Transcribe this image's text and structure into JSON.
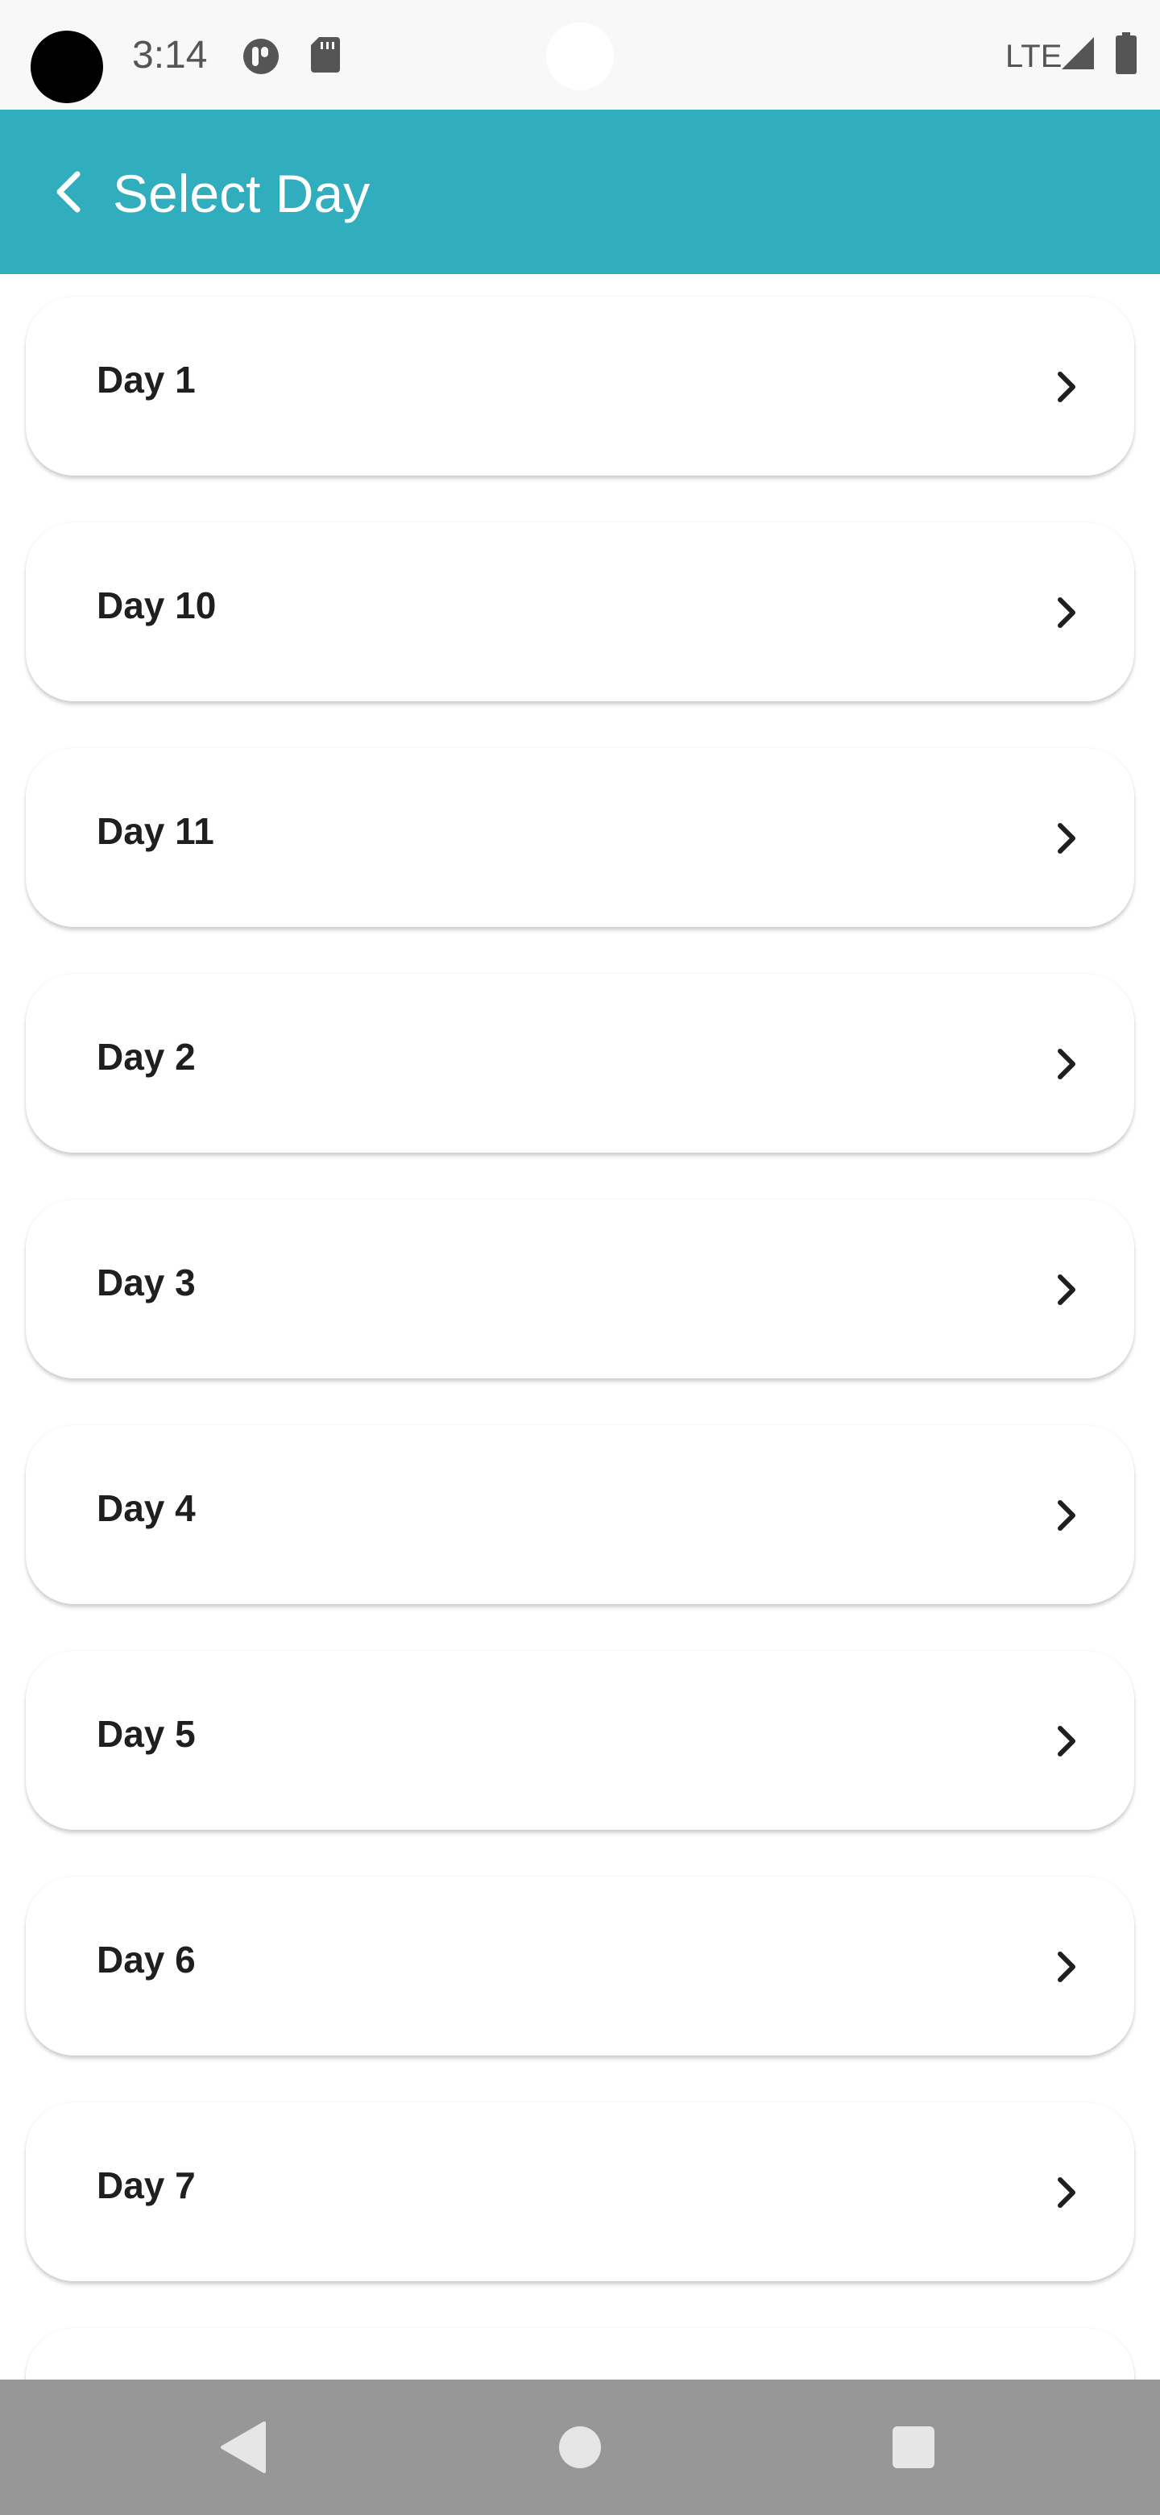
{
  "status_bar": {
    "time": "3:14",
    "network": "LTE",
    "icons": [
      "app-notification-icon",
      "sd-card-icon",
      "signal-icon",
      "battery-icon"
    ]
  },
  "app_bar": {
    "title": "Select Day",
    "back_icon": "arrow-back-icon",
    "color": "#31aebe"
  },
  "days": [
    {
      "label": "Day 1"
    },
    {
      "label": "Day 10"
    },
    {
      "label": "Day 11"
    },
    {
      "label": "Day 2"
    },
    {
      "label": "Day 3"
    },
    {
      "label": "Day 4"
    },
    {
      "label": "Day 5"
    },
    {
      "label": "Day 6"
    },
    {
      "label": "Day 7"
    },
    {
      "label": ""
    }
  ],
  "nav_bar": {
    "buttons": [
      "back-icon",
      "home-icon",
      "recents-icon"
    ]
  }
}
